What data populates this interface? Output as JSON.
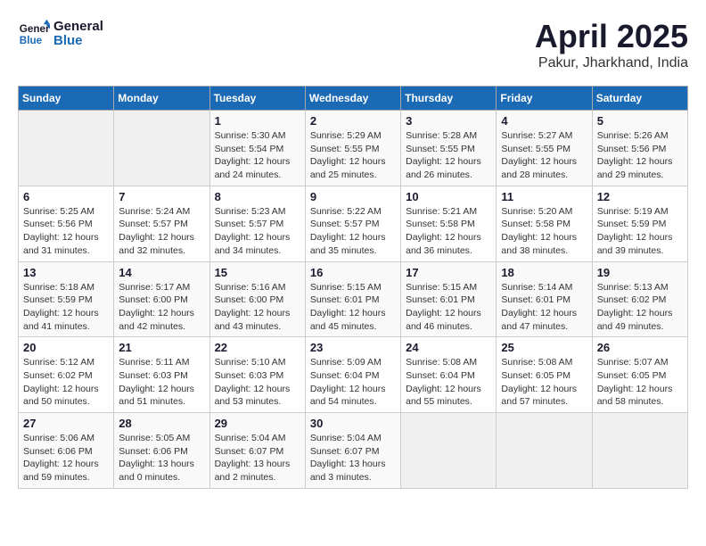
{
  "header": {
    "logo_line1": "General",
    "logo_line2": "Blue",
    "month": "April 2025",
    "location": "Pakur, Jharkhand, India"
  },
  "weekdays": [
    "Sunday",
    "Monday",
    "Tuesday",
    "Wednesday",
    "Thursday",
    "Friday",
    "Saturday"
  ],
  "weeks": [
    [
      {
        "day": "",
        "sunrise": "",
        "sunset": "",
        "daylight": ""
      },
      {
        "day": "",
        "sunrise": "",
        "sunset": "",
        "daylight": ""
      },
      {
        "day": "1",
        "sunrise": "Sunrise: 5:30 AM",
        "sunset": "Sunset: 5:54 PM",
        "daylight": "Daylight: 12 hours and 24 minutes."
      },
      {
        "day": "2",
        "sunrise": "Sunrise: 5:29 AM",
        "sunset": "Sunset: 5:55 PM",
        "daylight": "Daylight: 12 hours and 25 minutes."
      },
      {
        "day": "3",
        "sunrise": "Sunrise: 5:28 AM",
        "sunset": "Sunset: 5:55 PM",
        "daylight": "Daylight: 12 hours and 26 minutes."
      },
      {
        "day": "4",
        "sunrise": "Sunrise: 5:27 AM",
        "sunset": "Sunset: 5:55 PM",
        "daylight": "Daylight: 12 hours and 28 minutes."
      },
      {
        "day": "5",
        "sunrise": "Sunrise: 5:26 AM",
        "sunset": "Sunset: 5:56 PM",
        "daylight": "Daylight: 12 hours and 29 minutes."
      }
    ],
    [
      {
        "day": "6",
        "sunrise": "Sunrise: 5:25 AM",
        "sunset": "Sunset: 5:56 PM",
        "daylight": "Daylight: 12 hours and 31 minutes."
      },
      {
        "day": "7",
        "sunrise": "Sunrise: 5:24 AM",
        "sunset": "Sunset: 5:57 PM",
        "daylight": "Daylight: 12 hours and 32 minutes."
      },
      {
        "day": "8",
        "sunrise": "Sunrise: 5:23 AM",
        "sunset": "Sunset: 5:57 PM",
        "daylight": "Daylight: 12 hours and 34 minutes."
      },
      {
        "day": "9",
        "sunrise": "Sunrise: 5:22 AM",
        "sunset": "Sunset: 5:57 PM",
        "daylight": "Daylight: 12 hours and 35 minutes."
      },
      {
        "day": "10",
        "sunrise": "Sunrise: 5:21 AM",
        "sunset": "Sunset: 5:58 PM",
        "daylight": "Daylight: 12 hours and 36 minutes."
      },
      {
        "day": "11",
        "sunrise": "Sunrise: 5:20 AM",
        "sunset": "Sunset: 5:58 PM",
        "daylight": "Daylight: 12 hours and 38 minutes."
      },
      {
        "day": "12",
        "sunrise": "Sunrise: 5:19 AM",
        "sunset": "Sunset: 5:59 PM",
        "daylight": "Daylight: 12 hours and 39 minutes."
      }
    ],
    [
      {
        "day": "13",
        "sunrise": "Sunrise: 5:18 AM",
        "sunset": "Sunset: 5:59 PM",
        "daylight": "Daylight: 12 hours and 41 minutes."
      },
      {
        "day": "14",
        "sunrise": "Sunrise: 5:17 AM",
        "sunset": "Sunset: 6:00 PM",
        "daylight": "Daylight: 12 hours and 42 minutes."
      },
      {
        "day": "15",
        "sunrise": "Sunrise: 5:16 AM",
        "sunset": "Sunset: 6:00 PM",
        "daylight": "Daylight: 12 hours and 43 minutes."
      },
      {
        "day": "16",
        "sunrise": "Sunrise: 5:15 AM",
        "sunset": "Sunset: 6:01 PM",
        "daylight": "Daylight: 12 hours and 45 minutes."
      },
      {
        "day": "17",
        "sunrise": "Sunrise: 5:15 AM",
        "sunset": "Sunset: 6:01 PM",
        "daylight": "Daylight: 12 hours and 46 minutes."
      },
      {
        "day": "18",
        "sunrise": "Sunrise: 5:14 AM",
        "sunset": "Sunset: 6:01 PM",
        "daylight": "Daylight: 12 hours and 47 minutes."
      },
      {
        "day": "19",
        "sunrise": "Sunrise: 5:13 AM",
        "sunset": "Sunset: 6:02 PM",
        "daylight": "Daylight: 12 hours and 49 minutes."
      }
    ],
    [
      {
        "day": "20",
        "sunrise": "Sunrise: 5:12 AM",
        "sunset": "Sunset: 6:02 PM",
        "daylight": "Daylight: 12 hours and 50 minutes."
      },
      {
        "day": "21",
        "sunrise": "Sunrise: 5:11 AM",
        "sunset": "Sunset: 6:03 PM",
        "daylight": "Daylight: 12 hours and 51 minutes."
      },
      {
        "day": "22",
        "sunrise": "Sunrise: 5:10 AM",
        "sunset": "Sunset: 6:03 PM",
        "daylight": "Daylight: 12 hours and 53 minutes."
      },
      {
        "day": "23",
        "sunrise": "Sunrise: 5:09 AM",
        "sunset": "Sunset: 6:04 PM",
        "daylight": "Daylight: 12 hours and 54 minutes."
      },
      {
        "day": "24",
        "sunrise": "Sunrise: 5:08 AM",
        "sunset": "Sunset: 6:04 PM",
        "daylight": "Daylight: 12 hours and 55 minutes."
      },
      {
        "day": "25",
        "sunrise": "Sunrise: 5:08 AM",
        "sunset": "Sunset: 6:05 PM",
        "daylight": "Daylight: 12 hours and 57 minutes."
      },
      {
        "day": "26",
        "sunrise": "Sunrise: 5:07 AM",
        "sunset": "Sunset: 6:05 PM",
        "daylight": "Daylight: 12 hours and 58 minutes."
      }
    ],
    [
      {
        "day": "27",
        "sunrise": "Sunrise: 5:06 AM",
        "sunset": "Sunset: 6:06 PM",
        "daylight": "Daylight: 12 hours and 59 minutes."
      },
      {
        "day": "28",
        "sunrise": "Sunrise: 5:05 AM",
        "sunset": "Sunset: 6:06 PM",
        "daylight": "Daylight: 13 hours and 0 minutes."
      },
      {
        "day": "29",
        "sunrise": "Sunrise: 5:04 AM",
        "sunset": "Sunset: 6:07 PM",
        "daylight": "Daylight: 13 hours and 2 minutes."
      },
      {
        "day": "30",
        "sunrise": "Sunrise: 5:04 AM",
        "sunset": "Sunset: 6:07 PM",
        "daylight": "Daylight: 13 hours and 3 minutes."
      },
      {
        "day": "",
        "sunrise": "",
        "sunset": "",
        "daylight": ""
      },
      {
        "day": "",
        "sunrise": "",
        "sunset": "",
        "daylight": ""
      },
      {
        "day": "",
        "sunrise": "",
        "sunset": "",
        "daylight": ""
      }
    ]
  ]
}
